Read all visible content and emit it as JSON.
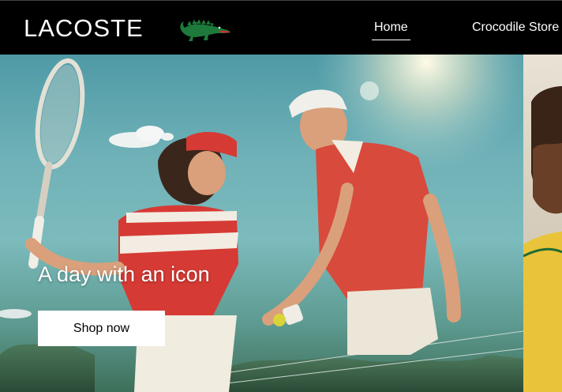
{
  "header": {
    "brand": "LACOSTE",
    "logo_icon": "crocodile-icon",
    "nav": [
      {
        "label": "Home",
        "active": true
      },
      {
        "label": "Crocodile Store",
        "active": false
      }
    ]
  },
  "hero": {
    "title": "A day with an icon",
    "cta_label": "Shop now"
  },
  "colors": {
    "header_bg": "#000000",
    "brand_green": "#1e7a3c",
    "croc_red": "#d62b2b",
    "button_bg": "#ffffff"
  }
}
